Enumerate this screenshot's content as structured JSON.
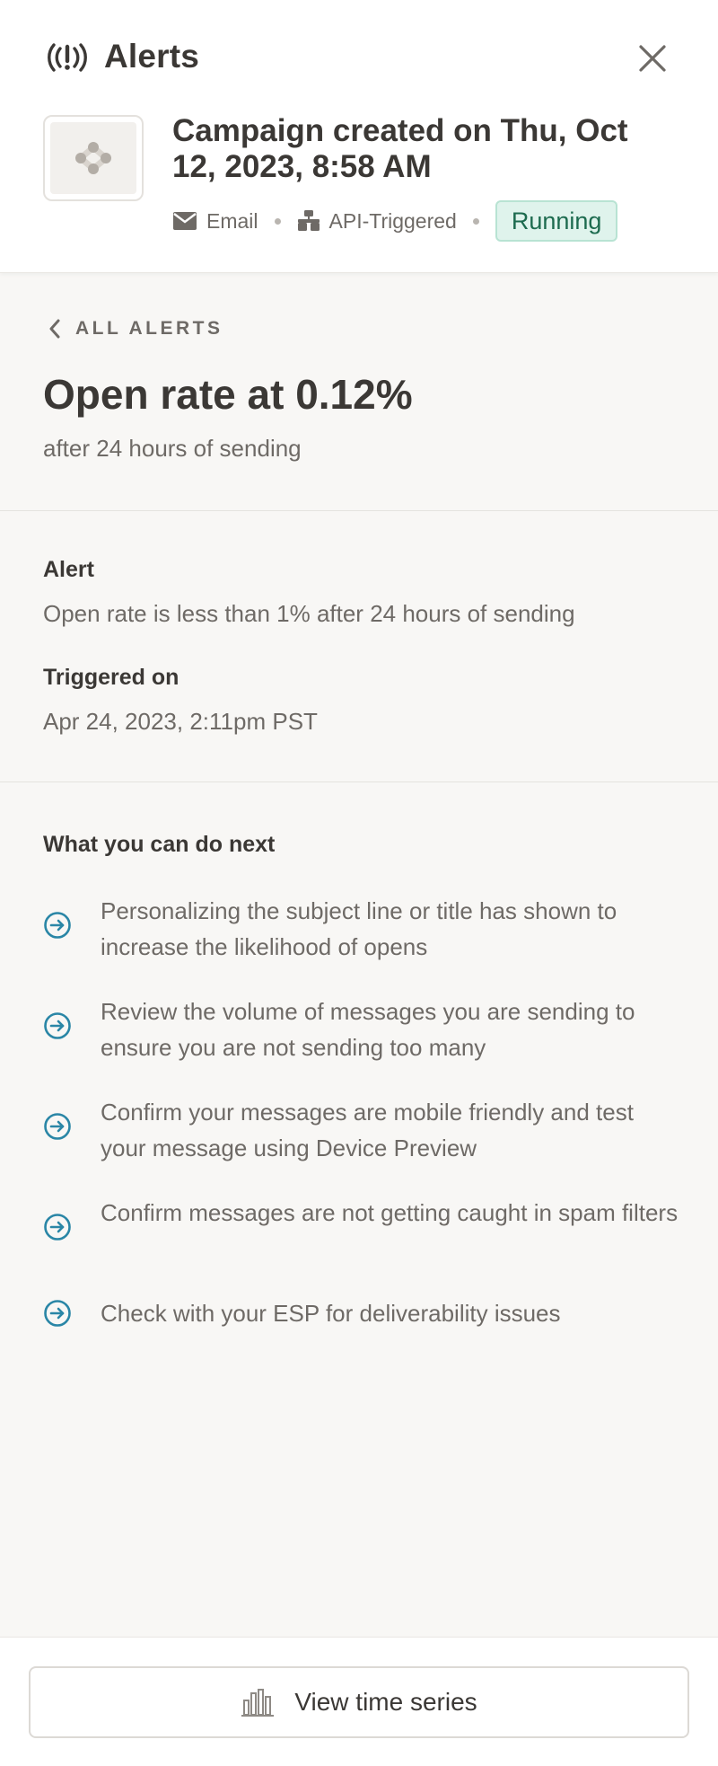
{
  "header": {
    "title": "Alerts",
    "campaign_title": "Campaign created on Thu, Oct 12, 2023, 8:58 AM",
    "channel": "Email",
    "trigger_type": "API-Triggered",
    "status": "Running"
  },
  "summary": {
    "back_label": "ALL ALERTS",
    "metric_title": "Open rate at 0.12%",
    "metric_sub": "after 24 hours of sending"
  },
  "details": {
    "alert_label": "Alert",
    "alert_value": "Open rate is less than 1% after 24 hours of sending",
    "triggered_label": "Triggered on",
    "triggered_value": "Apr 24, 2023, 2:11pm PST"
  },
  "next_steps": {
    "heading": "What you can do next",
    "items": [
      "Personalizing the subject line or title has shown to increase the likelihood of opens",
      "Review the volume of messages you are sending to ensure you are not sending too many",
      "Confirm your messages are mobile friendly and test your message using Device Preview",
      "Confirm messages are not getting caught in spam filters",
      "Check with your ESP for deliverability issues"
    ]
  },
  "footer": {
    "button_label": "View time series"
  },
  "colors": {
    "accent": "#2a86a6",
    "status_bg": "#dff3ec",
    "status_text": "#1d6b4f",
    "text_primary": "#3b3835",
    "text_secondary": "#6e6a66"
  },
  "icons": {
    "header": "alert-signal-icon",
    "close": "close-icon",
    "channel": "envelope-icon",
    "trigger": "api-trigger-icon",
    "back": "chevron-left-icon",
    "tip": "arrow-circle-right-icon",
    "series": "bar-chart-icon"
  }
}
